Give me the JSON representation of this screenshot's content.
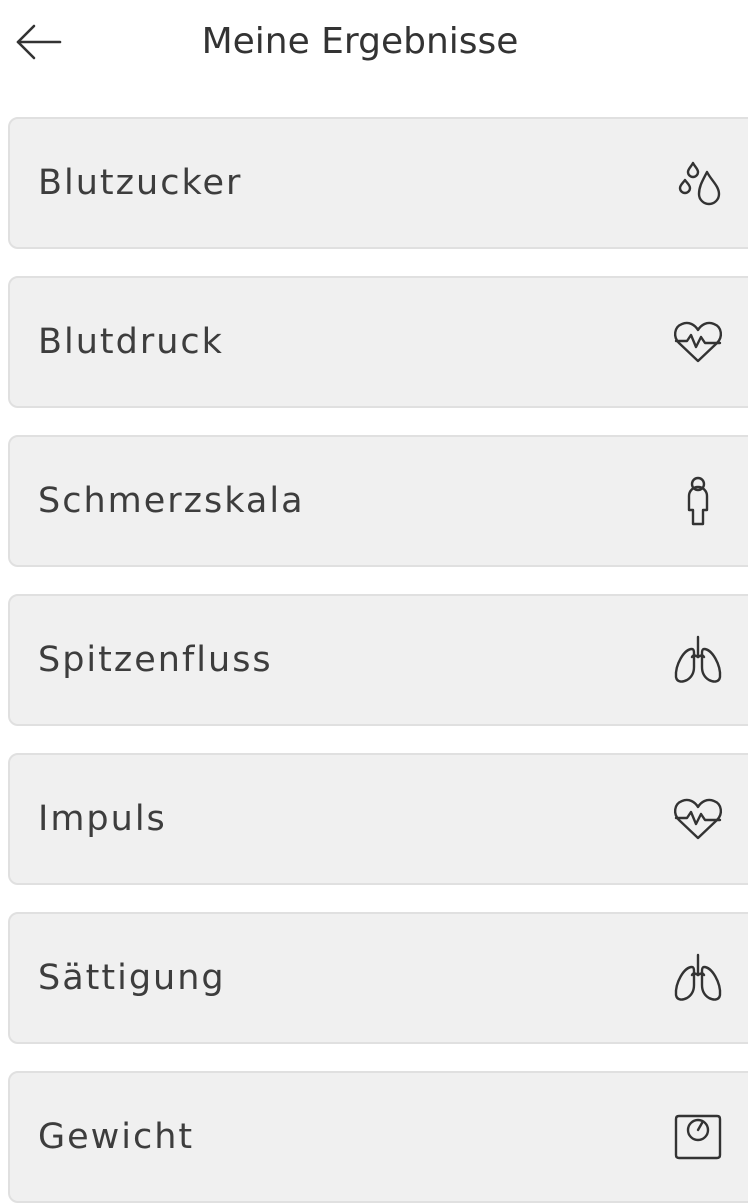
{
  "header": {
    "title": "Meine Ergebnisse",
    "back_icon": "arrow-left-icon"
  },
  "items": [
    {
      "label": "Blutzucker",
      "icon": "drops-icon"
    },
    {
      "label": "Blutdruck",
      "icon": "heart-pulse-icon"
    },
    {
      "label": "Schmerzskala",
      "icon": "person-icon"
    },
    {
      "label": "Spitzenfluss",
      "icon": "lungs-icon"
    },
    {
      "label": "Impuls",
      "icon": "heart-pulse-icon"
    },
    {
      "label": "Sättigung",
      "icon": "lungs-icon"
    },
    {
      "label": "Gewicht",
      "icon": "scale-icon"
    }
  ],
  "colors": {
    "card_background": "#f0f0f0",
    "card_border": "#e0e0e0",
    "text": "#3d3d3d"
  }
}
